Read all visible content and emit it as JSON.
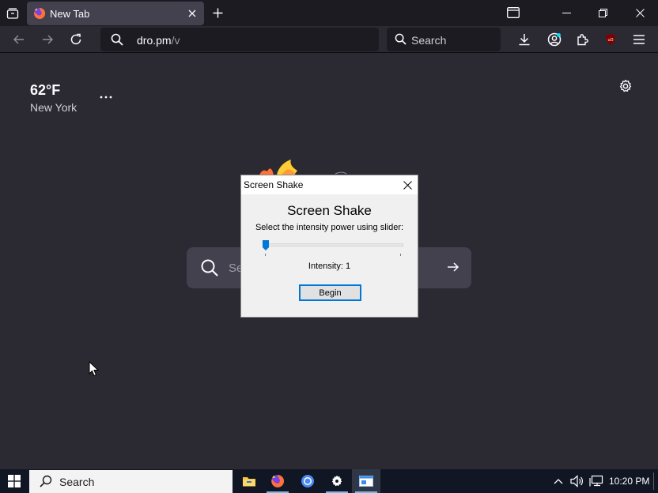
{
  "browser": {
    "tab": {
      "title": "New Tab",
      "favicon": "firefox-icon"
    },
    "url": {
      "host": "dro.pm",
      "path": "/v"
    },
    "search_placeholder": "Search",
    "toolbar_icons": [
      "download-icon",
      "account-icon",
      "extensions-icon",
      "ublock-icon",
      "menu-icon"
    ]
  },
  "newtab": {
    "weather": {
      "temperature": "62°F",
      "city": "New York"
    },
    "search_placeholder_partial": "Se"
  },
  "dialog": {
    "window_title": "Screen Shake",
    "heading": "Screen Shake",
    "instruction": "Select the intensity power using slider:",
    "intensity_label": "Intensity: 1",
    "slider_value": 1,
    "slider_min": 1,
    "slider_max": 10,
    "begin_button": "Begin"
  },
  "taskbar": {
    "search_placeholder": "Search",
    "apps": [
      "file-explorer-icon",
      "firefox-icon",
      "chrome-icon",
      "settings-icon",
      "screen-shake-app-icon"
    ],
    "clock": "10:20 PM"
  },
  "colors": {
    "browser_bg": "#2b2a33",
    "tabstrip_bg": "#1c1b22",
    "accent": "#0078d7",
    "taskbar_bg": "#101623"
  }
}
